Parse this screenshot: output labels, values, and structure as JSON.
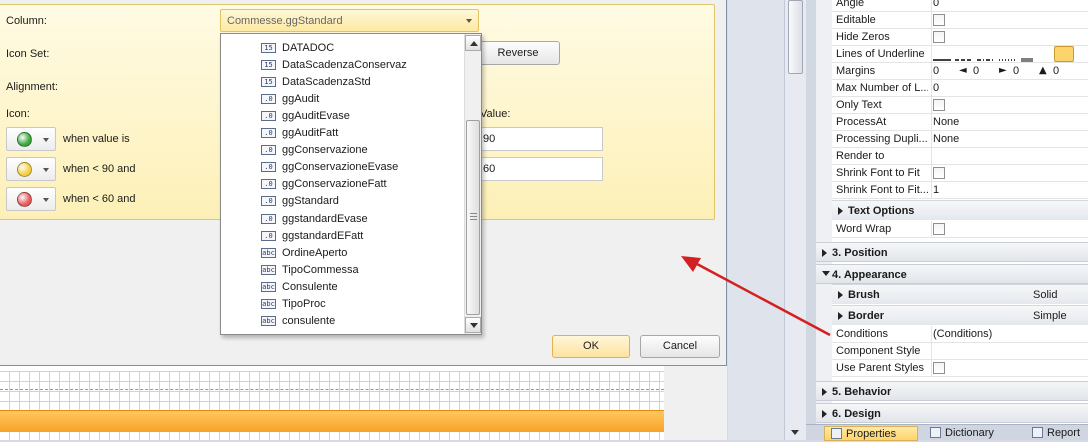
{
  "dialog": {
    "column_label": "Column:",
    "column_value": "Commesse.ggStandard",
    "icon_set_label": "Icon Set:",
    "alignment_label": "Alignment:",
    "icon_label": "Icon:",
    "value_label": "Value:",
    "reverse_button": "Reverse",
    "ok_button": "OK",
    "cancel_button": "Cancel",
    "rules": [
      {
        "color": "#3aa83a",
        "text": "when value is",
        "value": "90"
      },
      {
        "color": "#f5cf3c",
        "text": "when < 90 and",
        "value": "60"
      },
      {
        "color": "#e85a5a",
        "text": "when < 60 and",
        "value": ""
      }
    ]
  },
  "dropdown": {
    "items": [
      {
        "icon": "date-field-icon",
        "glyph": "15",
        "label": "DATADOC"
      },
      {
        "icon": "date-field-icon",
        "glyph": "15",
        "label": "DataScadenzaConservaz"
      },
      {
        "icon": "date-field-icon",
        "glyph": "15",
        "label": "DataScadenzaStd"
      },
      {
        "icon": "number-field-icon",
        "glyph": ".0",
        "label": "ggAudit"
      },
      {
        "icon": "number-field-icon",
        "glyph": ".0",
        "label": "ggAuditEvase"
      },
      {
        "icon": "number-field-icon",
        "glyph": ".0",
        "label": "ggAuditFatt"
      },
      {
        "icon": "number-field-icon",
        "glyph": ".0",
        "label": "ggConservazione"
      },
      {
        "icon": "number-field-icon",
        "glyph": ".0",
        "label": "ggConservazioneEvase"
      },
      {
        "icon": "number-field-icon",
        "glyph": ".0",
        "label": "ggConservazioneFatt"
      },
      {
        "icon": "number-field-icon",
        "glyph": ".0",
        "label": "ggStandard"
      },
      {
        "icon": "number-field-icon",
        "glyph": ".0",
        "label": "ggstandardEvase"
      },
      {
        "icon": "number-field-icon",
        "glyph": ".0",
        "label": "ggstandardEFatt"
      },
      {
        "icon": "text-field-icon",
        "glyph": "abc",
        "label": "OrdineAperto"
      },
      {
        "icon": "text-field-icon",
        "glyph": "abc",
        "label": "TipoCommessa"
      },
      {
        "icon": "text-field-icon",
        "glyph": "abc",
        "label": "Consulente"
      },
      {
        "icon": "text-field-icon",
        "glyph": "abc",
        "label": "TipoProc"
      },
      {
        "icon": "text-field-icon",
        "glyph": "abc",
        "label": "consulente"
      }
    ]
  },
  "props": {
    "rows": [
      {
        "name": "Angle",
        "value": "0",
        "kind": "text"
      },
      {
        "name": "Editable",
        "value": "",
        "kind": "check"
      },
      {
        "name": "Hide Zeros",
        "value": "",
        "kind": "check"
      },
      {
        "name": "Lines of Underline",
        "value": "",
        "kind": "lines"
      },
      {
        "name": "Margins",
        "value": "",
        "kind": "margins"
      },
      {
        "name": "Max Number of L...",
        "value": "0",
        "kind": "text"
      },
      {
        "name": "Only Text",
        "value": "",
        "kind": "check"
      },
      {
        "name": "ProcessAt",
        "value": "None",
        "kind": "text"
      },
      {
        "name": "Processing Dupli...",
        "value": "None",
        "kind": "text"
      },
      {
        "name": "Render to",
        "value": "",
        "kind": "text"
      },
      {
        "name": "Shrink Font to Fit",
        "value": "",
        "kind": "check"
      },
      {
        "name": "Shrink Font to Fit...",
        "value": "1",
        "kind": "text"
      }
    ],
    "margins": [
      "0",
      "0",
      "0",
      "0"
    ],
    "text_options": "Text Options",
    "word_wrap": "Word Wrap",
    "cat_position": "3. Position",
    "cat_appearance": "4. Appearance",
    "brush_label": "Brush",
    "brush_value": "Solid",
    "border_label": "Border",
    "border_value": "Simple",
    "appearance_rows": [
      {
        "name": "Conditions",
        "value": "(Conditions)",
        "kind": "text"
      },
      {
        "name": "Component Style",
        "value": "",
        "kind": "text"
      },
      {
        "name": "Use Parent Styles",
        "value": "",
        "kind": "check"
      }
    ],
    "cat_behavior": "5. Behavior",
    "cat_design": "6. Design"
  },
  "tabs": {
    "properties": "Properties",
    "dictionary": "Dictionary",
    "report": "Report"
  },
  "arrow_color": "#d42020",
  "accent_color": "#fdd36c"
}
